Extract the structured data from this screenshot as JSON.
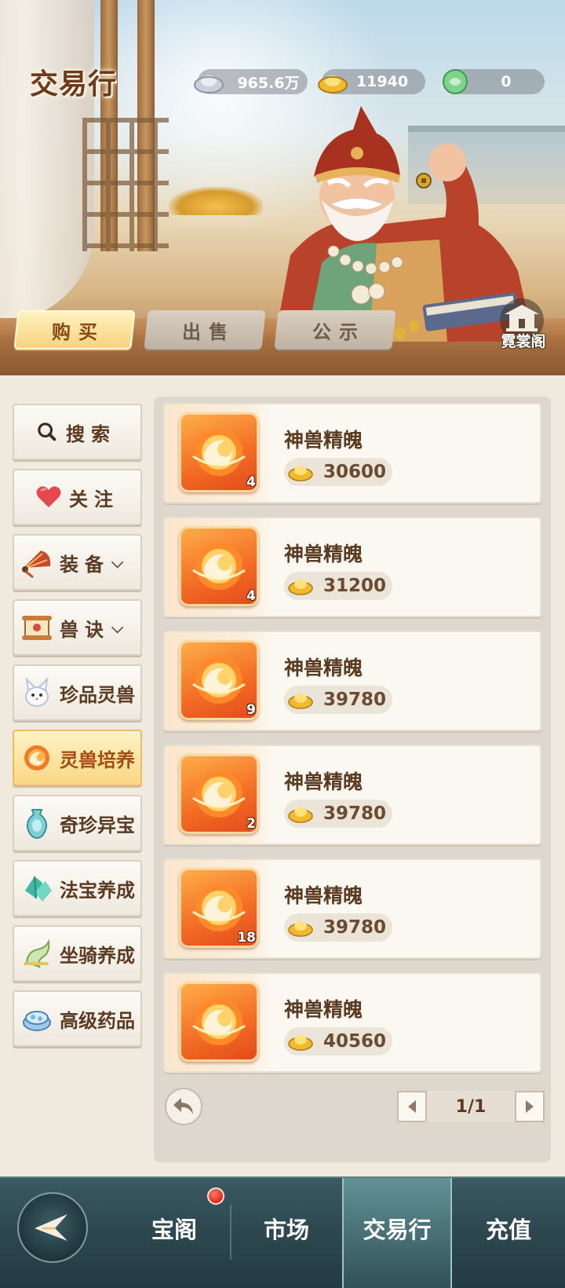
{
  "header": {
    "title": "交易行",
    "currencies": [
      {
        "icon": "silver-ingot-icon",
        "value": "965.6万"
      },
      {
        "icon": "gold-ingot-icon",
        "value": "11940"
      },
      {
        "icon": "jade-icon",
        "value": "0"
      }
    ],
    "tabs": [
      {
        "label": "购买",
        "active": true
      },
      {
        "label": "出售",
        "active": false
      },
      {
        "label": "公示",
        "active": false
      }
    ],
    "shop_link": {
      "label": "霓裳阁",
      "icon": "pavilion-icon"
    }
  },
  "sidebar": {
    "items": [
      {
        "label": "搜索",
        "icon": "search-icon",
        "active": false
      },
      {
        "label": "关注",
        "icon": "heart-icon",
        "active": false
      },
      {
        "label": "装备",
        "icon": "fan-icon",
        "active": false,
        "expandable": true
      },
      {
        "label": "兽诀",
        "icon": "scroll-icon",
        "active": false,
        "expandable": true
      },
      {
        "label": "珍品灵兽",
        "icon": "fox-icon",
        "active": false
      },
      {
        "label": "灵兽培养",
        "icon": "spirit-orb-icon",
        "active": true
      },
      {
        "label": "奇珍异宝",
        "icon": "vase-icon",
        "active": false
      },
      {
        "label": "法宝养成",
        "icon": "crystal-icon",
        "active": false
      },
      {
        "label": "坐骑养成",
        "icon": "mount-icon",
        "active": false
      },
      {
        "label": "高级药品",
        "icon": "medicine-icon",
        "active": false
      }
    ]
  },
  "listings": [
    {
      "name": "神兽精魄",
      "quantity": "4",
      "price": "30600"
    },
    {
      "name": "神兽精魄",
      "quantity": "4",
      "price": "31200"
    },
    {
      "name": "神兽精魄",
      "quantity": "9",
      "price": "39780"
    },
    {
      "name": "神兽精魄",
      "quantity": "2",
      "price": "39780"
    },
    {
      "name": "神兽精魄",
      "quantity": "18",
      "price": "39780"
    },
    {
      "name": "神兽精魄",
      "quantity": "",
      "price": "40560"
    }
  ],
  "pagination": {
    "current": "1/1"
  },
  "bottom_nav": {
    "items": [
      {
        "label": "宝阁",
        "active": false,
        "badge": true
      },
      {
        "label": "市场",
        "active": false
      },
      {
        "label": "交易行",
        "active": true
      },
      {
        "label": "充值",
        "active": false
      }
    ]
  },
  "colors": {
    "accent_active": "#f9d783",
    "text_brown": "#5b3a22",
    "nav_bg": "#2f4a52"
  }
}
